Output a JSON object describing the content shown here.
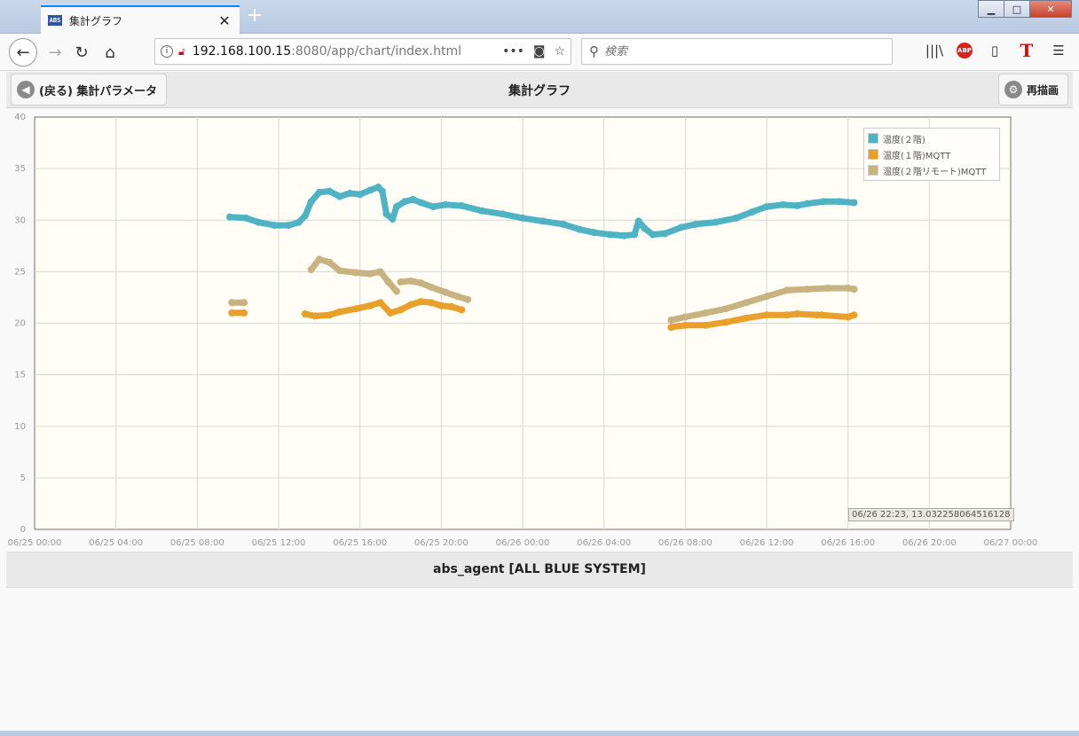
{
  "browser": {
    "tab_favicon": "ABS",
    "tab_title": "集計グラフ",
    "tab_close": "✕",
    "new_tab": "+",
    "url_host": "192.168.100.15",
    "url_rest": ":8080/app/chart/index.html",
    "search_placeholder": "検索",
    "icons": [
      "library-icon",
      "adblock-icon",
      "sidebar-icon",
      "t-icon",
      "menu-icon"
    ]
  },
  "header": {
    "back_label": "(戻る) 集計パラメータ",
    "title": "集計グラフ",
    "redraw_label": "再描画"
  },
  "footer": {
    "text": "abs_agent [ALL BLUE SYSTEM]"
  },
  "tooltip": {
    "text": "06/26 22:23, 13.032258064516128"
  },
  "colors": {
    "teal": "#4fb3c4",
    "orange": "#e8a02a",
    "tan": "#c8b27f",
    "plot_bg": "#fffdf6",
    "grid": "#d8d8d8"
  },
  "chart_data": {
    "type": "line",
    "ylim": [
      0,
      40
    ],
    "yticks": [
      "0",
      "5",
      "10",
      "15",
      "20",
      "25",
      "30",
      "35",
      "40"
    ],
    "xticks": [
      "06/25 00:00",
      "06/25 04:00",
      "06/25 08:00",
      "06/25 12:00",
      "06/25 16:00",
      "06/25 20:00",
      "06/26 00:00",
      "06/26 04:00",
      "06/26 08:00",
      "06/26 12:00",
      "06/26 16:00",
      "06/26 20:00",
      "06/27 00:00"
    ],
    "legend_position": "top-right",
    "series": [
      {
        "name": "温度(２階)",
        "color": "#4fb3c4",
        "segments": [
          [
            [
              9.6,
              30.3
            ],
            [
              10.4,
              30.2
            ],
            [
              11.0,
              29.8
            ],
            [
              11.8,
              29.5
            ],
            [
              12.5,
              29.5
            ],
            [
              13.0,
              29.8
            ],
            [
              13.3,
              30.4
            ],
            [
              13.6,
              31.8
            ],
            [
              14.0,
              32.7
            ],
            [
              14.5,
              32.8
            ],
            [
              15.0,
              32.3
            ],
            [
              15.5,
              32.6
            ],
            [
              16.0,
              32.5
            ],
            [
              16.5,
              32.9
            ],
            [
              16.9,
              33.2
            ],
            [
              17.1,
              32.8
            ],
            [
              17.3,
              30.6
            ],
            [
              17.6,
              30.1
            ],
            [
              17.8,
              31.3
            ],
            [
              18.2,
              31.8
            ],
            [
              18.6,
              32.0
            ],
            [
              19.0,
              31.7
            ],
            [
              19.6,
              31.3
            ],
            [
              20.2,
              31.5
            ],
            [
              21.0,
              31.4
            ],
            [
              22.0,
              30.9
            ],
            [
              23.0,
              30.6
            ],
            [
              24.0,
              30.2
            ],
            [
              25.0,
              29.9
            ],
            [
              26.0,
              29.6
            ],
            [
              26.8,
              29.1
            ],
            [
              27.5,
              28.8
            ],
            [
              28.3,
              28.6
            ],
            [
              29.0,
              28.5
            ],
            [
              29.5,
              28.6
            ],
            [
              29.7,
              29.9
            ],
            [
              30.0,
              29.2
            ],
            [
              30.4,
              28.6
            ],
            [
              31.0,
              28.7
            ],
            [
              31.8,
              29.3
            ],
            [
              32.5,
              29.6
            ],
            [
              33.5,
              29.8
            ],
            [
              34.5,
              30.2
            ],
            [
              35.3,
              30.8
            ],
            [
              36.0,
              31.3
            ],
            [
              36.8,
              31.5
            ],
            [
              37.5,
              31.4
            ],
            [
              38.0,
              31.6
            ],
            [
              38.8,
              31.8
            ],
            [
              39.6,
              31.8
            ],
            [
              40.3,
              31.7
            ]
          ]
        ]
      },
      {
        "name": "温度(１階)MQTT",
        "color": "#e8a02a",
        "segments": [
          [
            [
              9.7,
              21.0
            ],
            [
              10.3,
              21.0
            ]
          ],
          [
            [
              13.3,
              20.9
            ],
            [
              13.8,
              20.7
            ],
            [
              14.5,
              20.8
            ],
            [
              15.0,
              21.1
            ],
            [
              15.8,
              21.4
            ],
            [
              16.5,
              21.7
            ],
            [
              17.0,
              22.0
            ],
            [
              17.5,
              21.0
            ],
            [
              18.0,
              21.3
            ],
            [
              18.5,
              21.8
            ],
            [
              19.0,
              22.1
            ],
            [
              19.5,
              22.0
            ],
            [
              20.0,
              21.7
            ],
            [
              20.5,
              21.6
            ],
            [
              21.0,
              21.3
            ]
          ],
          [
            [
              31.3,
              19.6
            ],
            [
              32.0,
              19.8
            ],
            [
              33.0,
              19.8
            ],
            [
              34.0,
              20.1
            ],
            [
              35.0,
              20.5
            ],
            [
              36.0,
              20.8
            ],
            [
              37.0,
              20.8
            ],
            [
              37.5,
              20.9
            ],
            [
              38.5,
              20.8
            ]
          ],
          [
            [
              38.7,
              20.8
            ],
            [
              40.0,
              20.6
            ],
            [
              40.3,
              20.8
            ]
          ]
        ]
      },
      {
        "name": "温度(２階リモート)MQTT",
        "color": "#c8b27f",
        "segments": [
          [
            [
              9.7,
              22.0
            ],
            [
              10.3,
              22.0
            ]
          ],
          [
            [
              13.6,
              25.2
            ],
            [
              14.0,
              26.2
            ],
            [
              14.5,
              25.9
            ],
            [
              15.0,
              25.1
            ],
            [
              15.8,
              24.9
            ],
            [
              16.5,
              24.8
            ],
            [
              17.0,
              25.0
            ],
            [
              17.4,
              24.0
            ],
            [
              17.8,
              23.1
            ]
          ],
          [
            [
              18.0,
              24.0
            ],
            [
              18.5,
              24.1
            ],
            [
              19.0,
              23.9
            ],
            [
              19.5,
              23.5
            ],
            [
              20.2,
              23.0
            ],
            [
              20.8,
              22.6
            ],
            [
              21.3,
              22.3
            ]
          ],
          [
            [
              31.3,
              20.3
            ],
            [
              32.0,
              20.6
            ],
            [
              33.0,
              21.0
            ],
            [
              34.0,
              21.4
            ],
            [
              35.0,
              22.0
            ],
            [
              36.0,
              22.6
            ],
            [
              37.0,
              23.2
            ],
            [
              38.0,
              23.3
            ],
            [
              39.0,
              23.4
            ],
            [
              40.0,
              23.4
            ],
            [
              40.3,
              23.3
            ]
          ]
        ]
      }
    ]
  }
}
